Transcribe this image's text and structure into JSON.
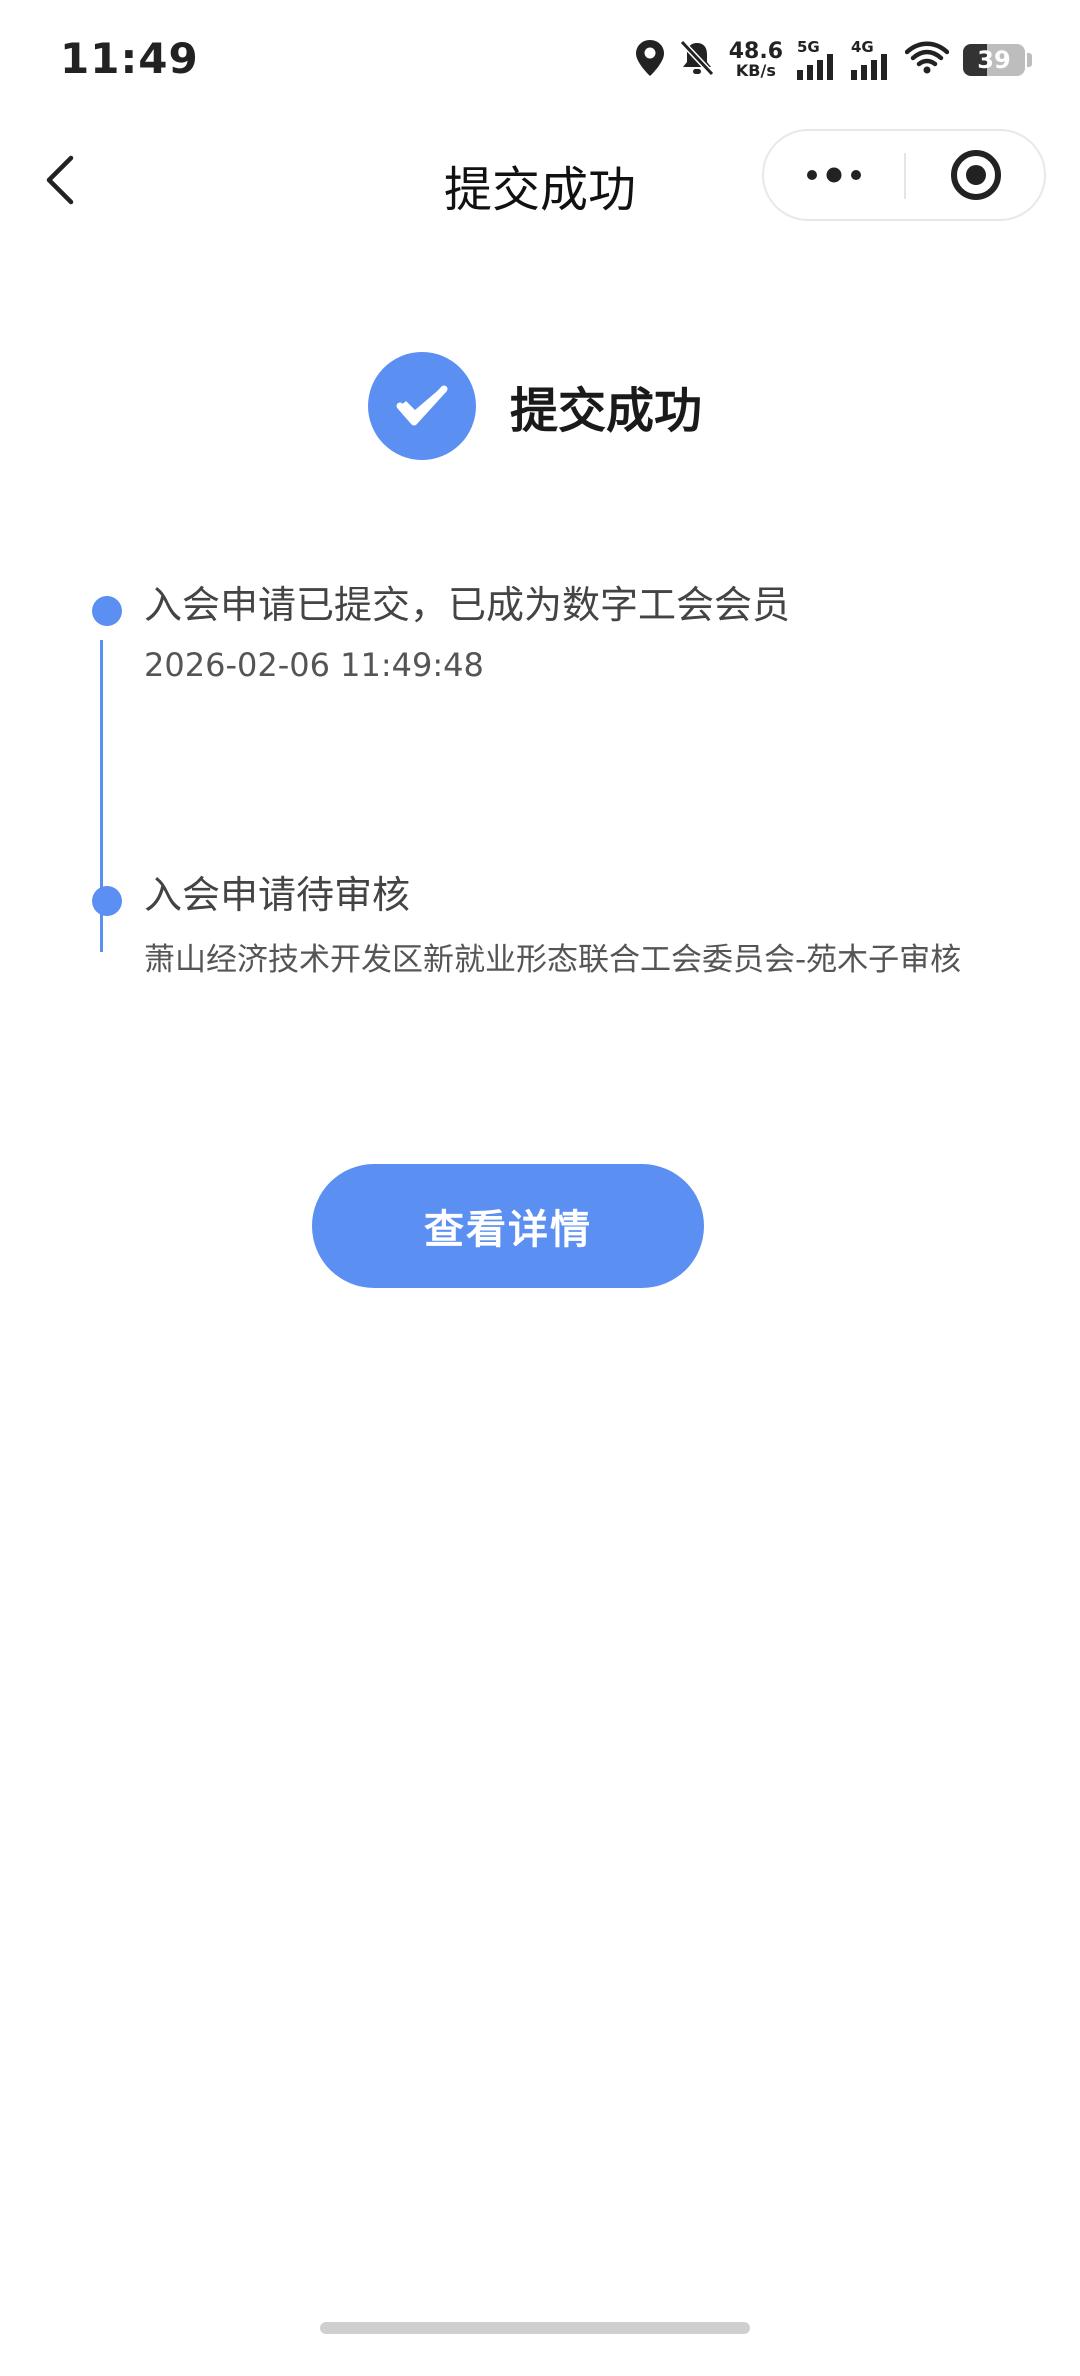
{
  "status_bar": {
    "time": "11:49",
    "net_speed_value": "48.6",
    "net_speed_unit": "KB/s",
    "signal_1_label": "5G",
    "signal_2_label": "4G",
    "battery_level": "39",
    "battery_fraction": 0.39
  },
  "nav": {
    "title": "提交成功"
  },
  "success": {
    "title": "提交成功",
    "accent_color": "#5b8ff2"
  },
  "timeline": {
    "items": [
      {
        "title": "入会申请已提交，已成为数字工会会员",
        "subtitle": "2026-02-06 11:49:48"
      },
      {
        "title": "入会申请待审核",
        "subtitle": "萧山经济技术开发区新就业形态联合工会委员会-苑木子审核"
      }
    ]
  },
  "actions": {
    "detail_label": "查看详情"
  },
  "icons": {
    "back": "back-arrow-icon",
    "more": "more-dots-icon",
    "close": "target-close-icon",
    "check": "checkmark-icon",
    "location": "location-icon",
    "mute": "bell-muted-icon",
    "wifi": "wifi-icon"
  }
}
